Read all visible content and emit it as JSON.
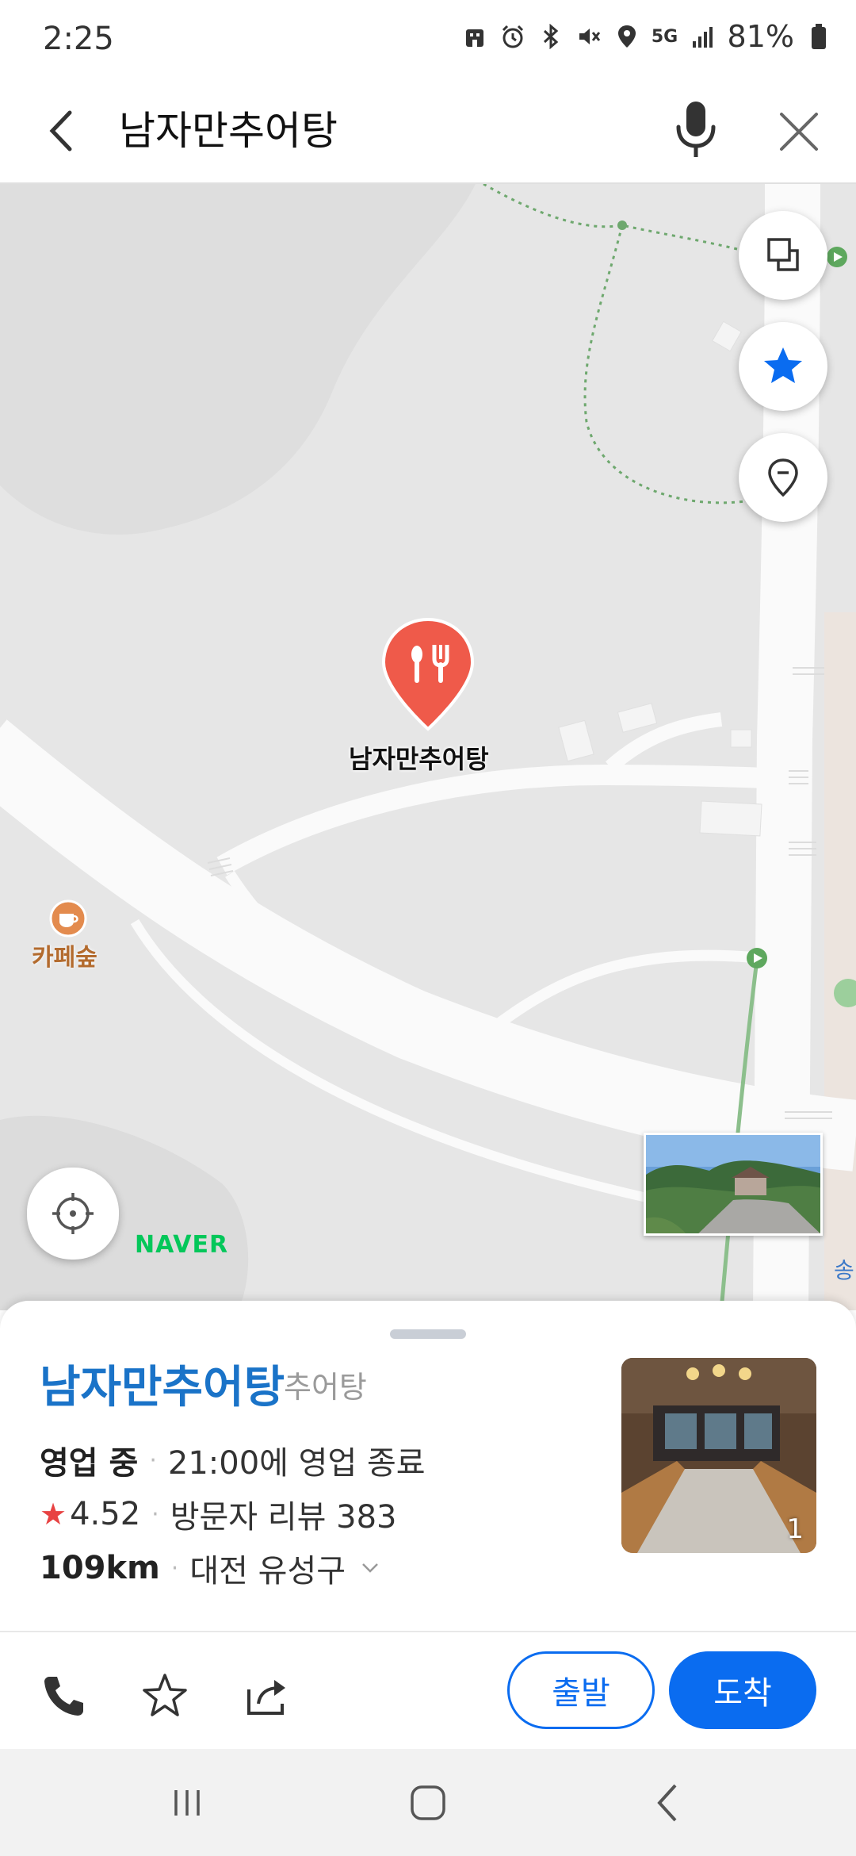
{
  "status_bar": {
    "time": "2:25",
    "network": "5G",
    "battery": "81%"
  },
  "search": {
    "query": "남자만추어탕"
  },
  "map": {
    "pin_label": "남자만추어탕",
    "poi_cafe_label": "카페숲",
    "provider_logo": "NAVER",
    "edge_label": "송"
  },
  "place": {
    "name": "남자만추어탕",
    "category": "추어탕",
    "status": "영업 중",
    "hours": "21:00에 영업 종료",
    "rating": "4.52",
    "reviews": "방문자 리뷰 383",
    "distance": "109km",
    "address": "대전 유성구",
    "photo_count": "1"
  },
  "actions": {
    "depart_label": "출발",
    "arrive_label": "도착"
  },
  "colors": {
    "accent": "#0a6cf0",
    "place_name": "#1a73c8",
    "pin": "#ef5a4a",
    "naver": "#03c75a"
  }
}
